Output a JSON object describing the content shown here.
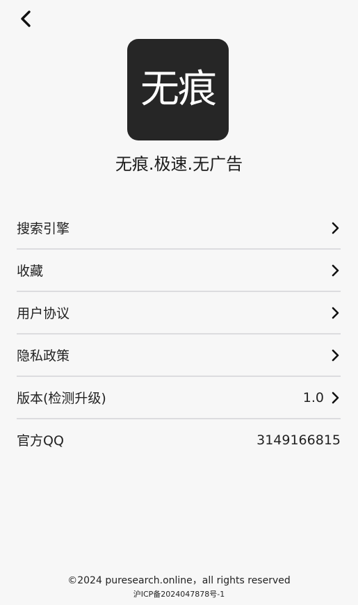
{
  "header": {
    "back_icon": "chevron-left-icon"
  },
  "app": {
    "logo_text": "无痕",
    "tagline": "无痕.极速.无广告"
  },
  "menu": {
    "items": [
      {
        "label": "搜索引擎",
        "value": "",
        "icon": "chevron-right-icon"
      },
      {
        "label": "收藏",
        "value": "",
        "icon": "chevron-right-icon"
      },
      {
        "label": "用户协议",
        "value": "",
        "icon": "chevron-right-icon"
      },
      {
        "label": "隐私政策",
        "value": "",
        "icon": "chevron-right-icon"
      },
      {
        "label": "版本(检测升级)",
        "value": "1.0",
        "icon": "chevron-right-icon"
      },
      {
        "label": "官方QQ",
        "value": "3149166815"
      }
    ]
  },
  "footer": {
    "copyright": "©2024 puresearch.online，all rights reserved",
    "icp": "沪ICP备2024047878号-1"
  },
  "colors": {
    "background": "#f7f7f7",
    "logo_background": "#262626",
    "divider": "#dcdcdf",
    "text": "#222222"
  }
}
